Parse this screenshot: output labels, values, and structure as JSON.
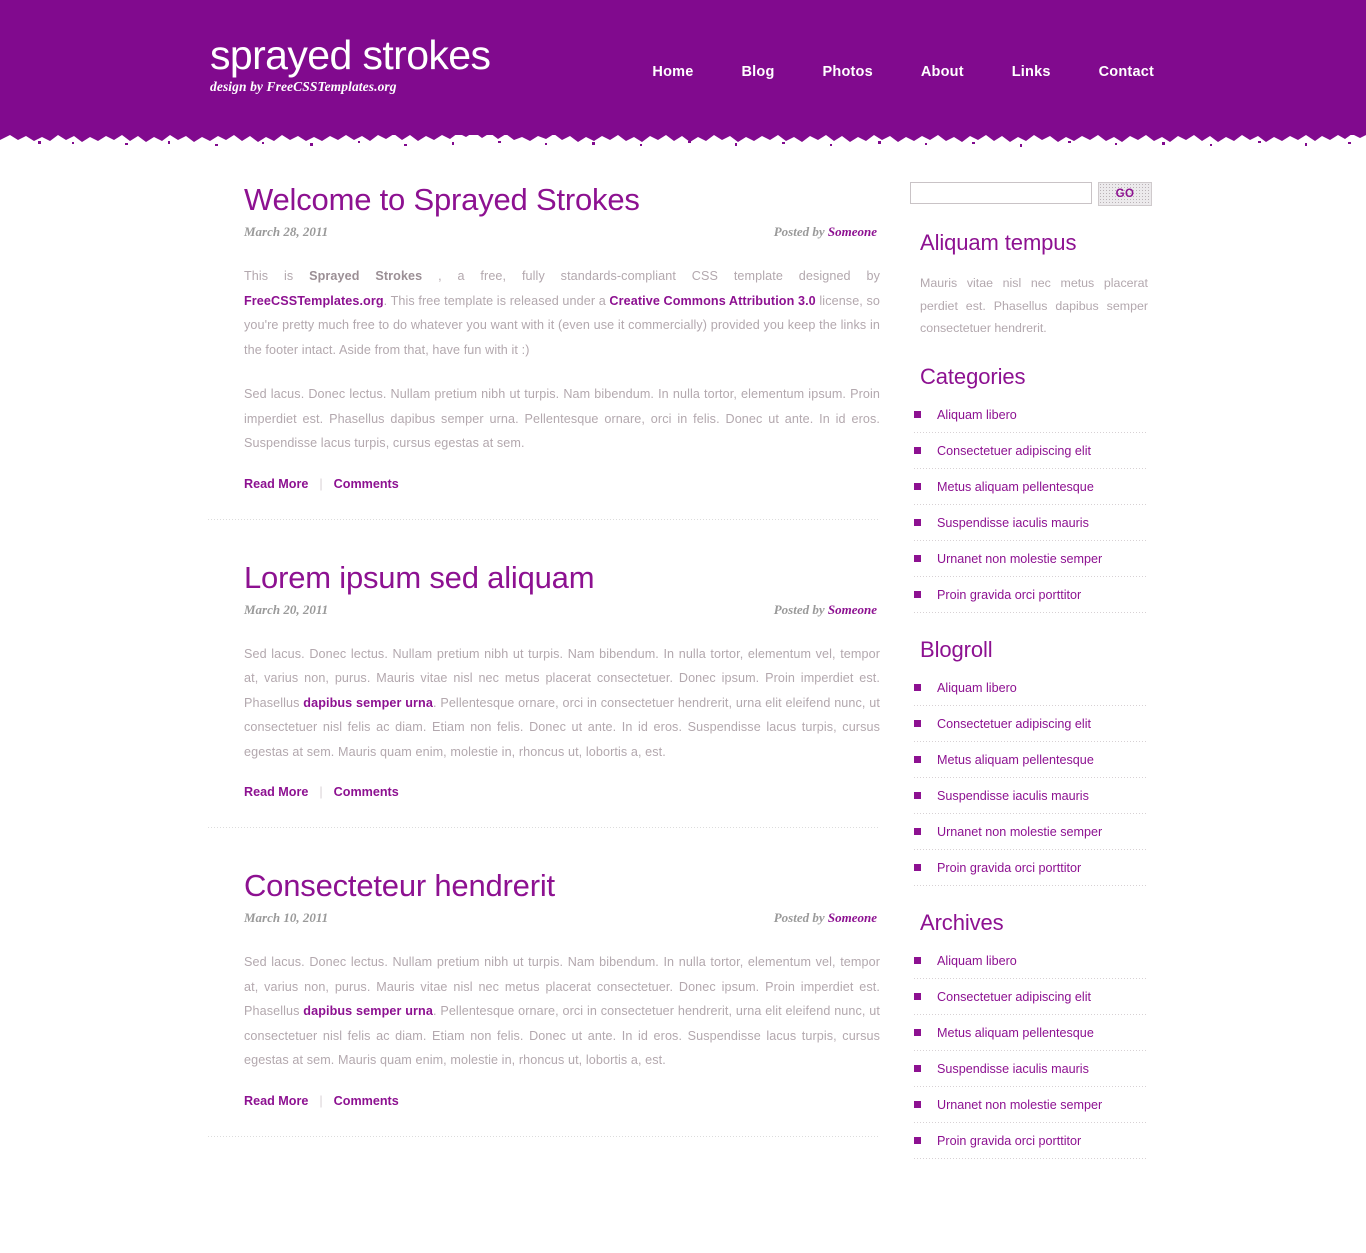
{
  "site": {
    "title": "sprayed strokes",
    "tagline": "design by FreeCSSTemplates.org",
    "accent_color": "#8D1191",
    "header_bg": "#810A8E"
  },
  "nav": {
    "items": [
      {
        "label": "Home"
      },
      {
        "label": "Blog"
      },
      {
        "label": "Photos"
      },
      {
        "label": "About"
      },
      {
        "label": "Links"
      },
      {
        "label": "Contact"
      }
    ]
  },
  "posts": [
    {
      "title": "Welcome to Sprayed Strokes",
      "date": "March 28, 2011",
      "posted_by_label": "Posted by",
      "author": "Someone",
      "para1_a": "This is ",
      "para1_b": "Sprayed Strokes",
      "para1_c": " , a free, fully standards-compliant CSS template designed by ",
      "para1_link1": "FreeCSSTemplates.org",
      "para1_d": ". This free template is released under a ",
      "para1_link2": "Creative Commons Attribution 3.0",
      "para1_e": " license, so you're pretty much free to do whatever you want with it (even use it commercially) provided you keep the links in the footer intact. Aside from that, have fun with it :)",
      "para2": "Sed lacus. Donec lectus. Nullam pretium nibh ut turpis. Nam bibendum. In nulla tortor, elementum ipsum. Proin imperdiet est. Phasellus dapibus semper urna. Pellentesque ornare, orci in felis. Donec ut ante. In id eros. Suspendisse lacus turpis, cursus egestas at sem.",
      "read_more": "Read More",
      "separator": "|",
      "comments": "Comments"
    },
    {
      "title": "Lorem ipsum sed aliquam",
      "date": "March 20, 2011",
      "posted_by_label": "Posted by",
      "author": "Someone",
      "body_a": "Sed lacus. Donec lectus. Nullam pretium nibh ut turpis. Nam bibendum. In nulla tortor, elementum vel, tempor at, varius non, purus. Mauris vitae nisl nec metus placerat consectetuer. Donec ipsum. Proin imperdiet est. Phasellus ",
      "body_link": "dapibus semper urna",
      "body_b": ". Pellentesque ornare, orci in consectetuer hendrerit, urna elit eleifend nunc, ut consectetuer nisl felis ac diam. Etiam non felis. Donec ut ante. In id eros. Suspendisse lacus turpis, cursus egestas at sem. Mauris quam enim, molestie in, rhoncus ut, lobortis a, est.",
      "read_more": "Read More",
      "separator": "|",
      "comments": "Comments"
    },
    {
      "title": "Consecteteur hendrerit",
      "date": "March 10, 2011",
      "posted_by_label": "Posted by",
      "author": "Someone",
      "body_a": "Sed lacus. Donec lectus. Nullam pretium nibh ut turpis. Nam bibendum. In nulla tortor, elementum vel, tempor at, varius non, purus. Mauris vitae nisl nec metus placerat consectetuer. Donec ipsum. Proin imperdiet est. Phasellus ",
      "body_link": "dapibus semper urna",
      "body_b": ". Pellentesque ornare, orci in consectetuer hendrerit, urna elit eleifend nunc, ut consectetuer nisl felis ac diam. Etiam non felis. Donec ut ante. In id eros. Suspendisse lacus turpis, cursus egestas at sem. Mauris quam enim, molestie in, rhoncus ut, lobortis a, est.",
      "read_more": "Read More",
      "separator": "|",
      "comments": "Comments"
    }
  ],
  "sidebar": {
    "search": {
      "value": "",
      "placeholder": "",
      "go_label": "GO"
    },
    "about": {
      "title": "Aliquam tempus",
      "text": "Mauris vitae nisl nec metus placerat perdiet est. Phasellus dapibus semper consectetuer hendrerit."
    },
    "categories": {
      "title": "Categories",
      "items": [
        "Aliquam libero",
        "Consectetuer adipiscing elit",
        "Metus aliquam pellentesque",
        "Suspendisse iaculis mauris",
        "Urnanet non molestie semper",
        "Proin gravida orci porttitor"
      ]
    },
    "blogroll": {
      "title": "Blogroll",
      "items": [
        "Aliquam libero",
        "Consectetuer adipiscing elit",
        "Metus aliquam pellentesque",
        "Suspendisse iaculis mauris",
        "Urnanet non molestie semper",
        "Proin gravida orci porttitor"
      ]
    },
    "archives": {
      "title": "Archives",
      "items": [
        "Aliquam libero",
        "Consectetuer adipiscing elit",
        "Metus aliquam pellentesque",
        "Suspendisse iaculis mauris",
        "Urnanet non molestie semper",
        "Proin gravida orci porttitor"
      ]
    }
  }
}
